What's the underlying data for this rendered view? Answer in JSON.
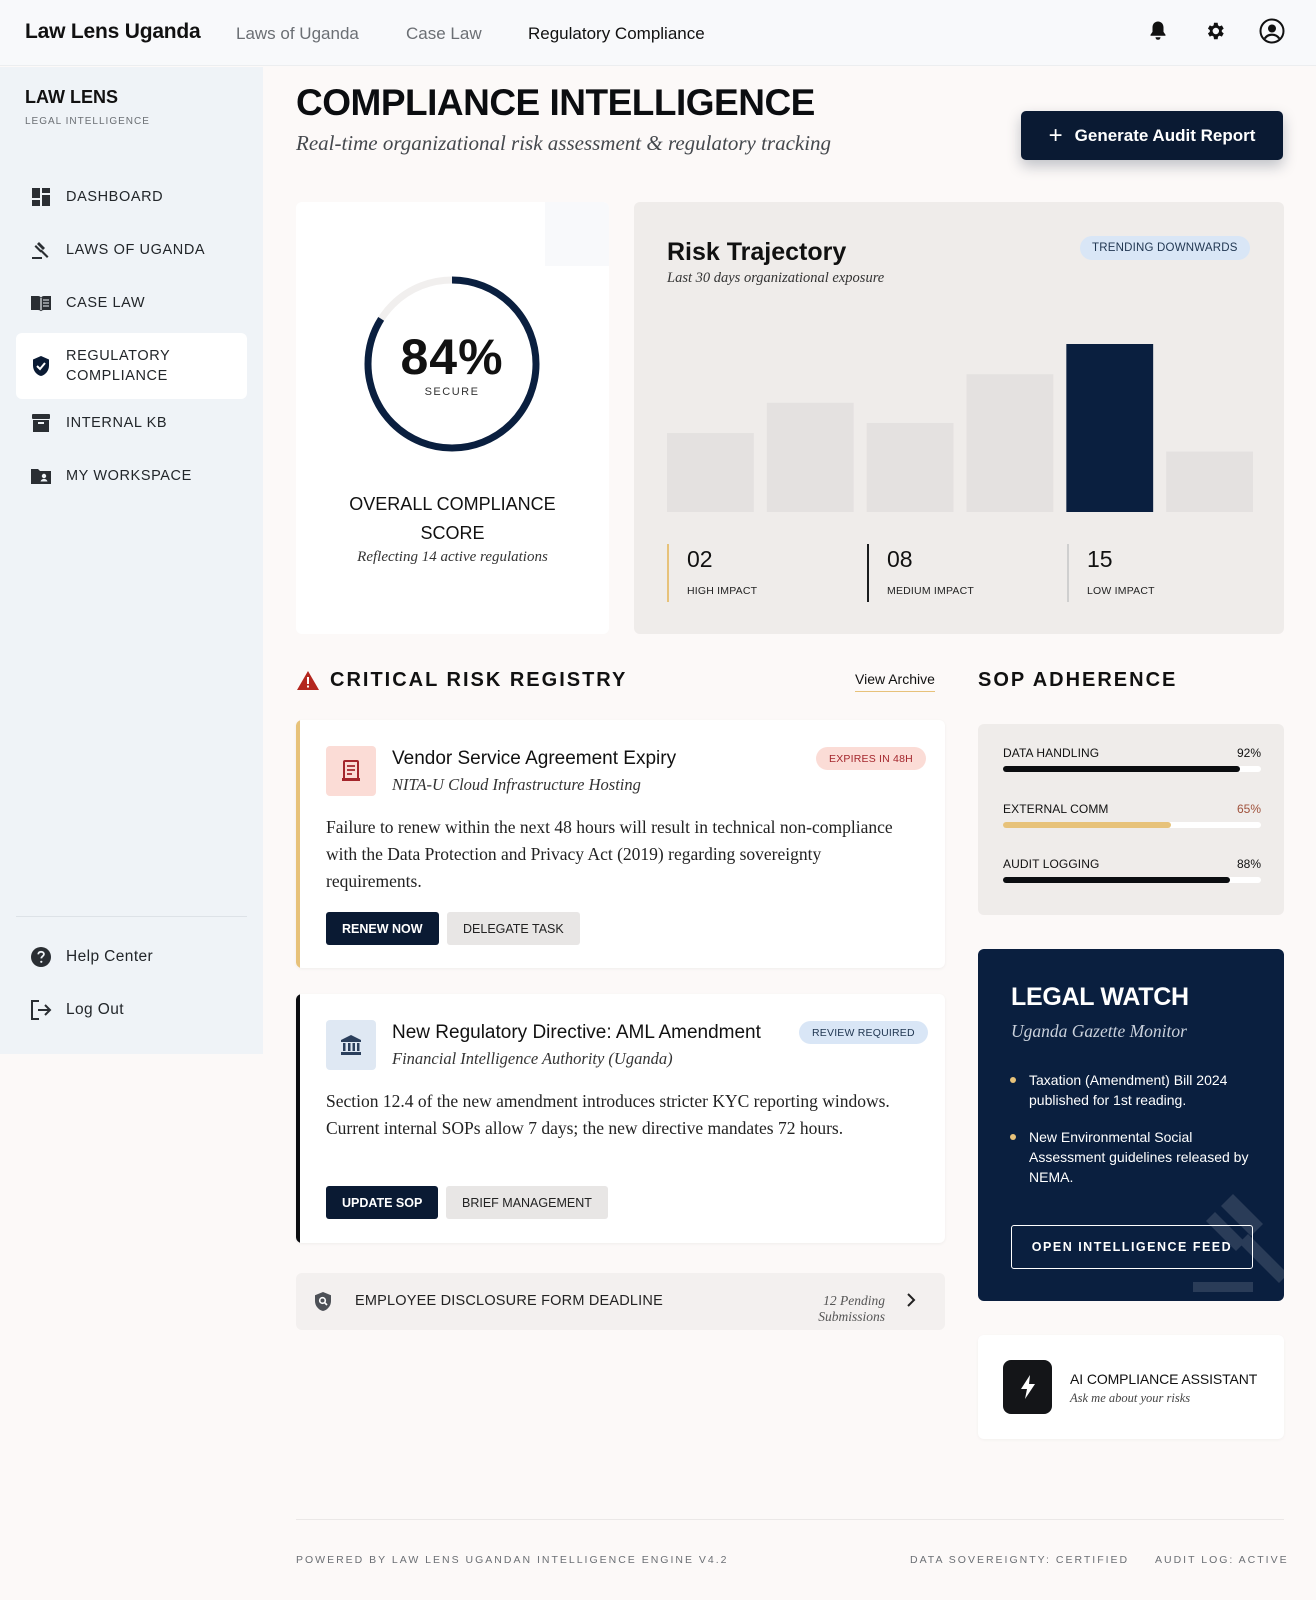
{
  "topbar": {
    "brand": "Law Lens Uganda",
    "nav": [
      "Laws of Uganda",
      "Case Law",
      "Regulatory Compliance"
    ],
    "active_nav": "Regulatory Compliance"
  },
  "sidebar": {
    "title": "LAW LENS",
    "subtitle": "LEGAL INTELLIGENCE",
    "items": [
      {
        "label": "DASHBOARD",
        "icon": "dashboard-icon"
      },
      {
        "label": "LAWS OF UGANDA",
        "icon": "gavel-icon"
      },
      {
        "label": "CASE LAW",
        "icon": "book-icon"
      },
      {
        "label": "REGULATORY COMPLIANCE",
        "icon": "shield-icon",
        "active": true
      },
      {
        "label": "INTERNAL KB",
        "icon": "archive-icon"
      },
      {
        "label": "MY WORKSPACE",
        "icon": "folder-user-icon"
      }
    ],
    "footer": [
      {
        "label": "Help Center",
        "icon": "help-icon"
      },
      {
        "label": "Log Out",
        "icon": "logout-icon"
      }
    ]
  },
  "header": {
    "title": "COMPLIANCE INTELLIGENCE",
    "subtitle": "Real-time organizational risk assessment & regulatory tracking",
    "button": "Generate Audit Report"
  },
  "score": {
    "value": "84%",
    "percent": 84,
    "label": "SECURE",
    "title": "OVERALL COMPLIANCE SCORE",
    "subtitle": "Reflecting 14 active regulations"
  },
  "trajectory": {
    "title": "Risk Trajectory",
    "subtitle": "Last 30 days organizational exposure",
    "badge": "TRENDING DOWNWARDS",
    "bars": [
      0.47,
      0.65,
      0.53,
      0.82,
      1.0,
      0.36
    ],
    "highlight_index": 4,
    "stats": [
      {
        "num": "02",
        "cap": "HIGH IMPACT",
        "color": "#e7c27a"
      },
      {
        "num": "08",
        "cap": "MEDIUM IMPACT",
        "color": "#1a1c1e"
      },
      {
        "num": "15",
        "cap": "LOW IMPACT",
        "color": "#cfcfcf"
      }
    ]
  },
  "registry": {
    "heading": "CRITICAL RISK REGISTRY",
    "view_archive": "View Archive",
    "risks": [
      {
        "title": "Vendor Service Agreement Expiry",
        "org": "NITA-U Cloud Infrastructure Hosting",
        "badge": "EXPIRES IN 48H",
        "description": "Failure to renew within the next 48 hours will result in technical non-compliance with the Data Protection and Privacy Act (2019) regarding sovereignty requirements.",
        "primary": "RENEW NOW",
        "secondary": "DELEGATE TASK"
      },
      {
        "title": "New Regulatory Directive: AML Amendment",
        "org": "Financial Intelligence Authority (Uganda)",
        "badge": "REVIEW REQUIRED",
        "description": "Section 12.4 of the new amendment introduces stricter KYC reporting windows. Current internal SOPs allow 7 days; the new directive mandates 72 hours.",
        "primary": "UPDATE SOP",
        "secondary": "BRIEF MANAGEMENT"
      }
    ],
    "deadline": {
      "label": "EMPLOYEE DISCLOSURE FORM DEADLINE",
      "pending": "12 Pending Submissions"
    }
  },
  "sop": {
    "heading": "SOP ADHERENCE",
    "rows": [
      {
        "name": "DATA HANDLING",
        "pct": "92%",
        "value": 0.92,
        "color": "#0b0d10",
        "pct_color": "#111111"
      },
      {
        "name": "EXTERNAL COMM",
        "pct": "65%",
        "value": 0.65,
        "color": "#e7c27a",
        "pct_color": "#a0523c"
      },
      {
        "name": "AUDIT LOGGING",
        "pct": "88%",
        "value": 0.88,
        "color": "#0b0d10",
        "pct_color": "#111111"
      }
    ]
  },
  "watch": {
    "title": "LEGAL WATCH",
    "subtitle": "Uganda Gazette Monitor",
    "items": [
      "Taxation (Amendment) Bill 2024 published for 1st reading.",
      "New Environmental Social Assessment guidelines released by NEMA."
    ],
    "button": "OPEN INTELLIGENCE FEED"
  },
  "assistant": {
    "title": "AI COMPLIANCE ASSISTANT",
    "subtitle": "Ask me about your risks"
  },
  "footer": {
    "left": "POWERED BY LAW LENS UGANDAN INTELLIGENCE ENGINE V4.2",
    "mid": "DATA SOVEREIGNTY: CERTIFIED",
    "right": "AUDIT LOG: ACTIVE"
  }
}
